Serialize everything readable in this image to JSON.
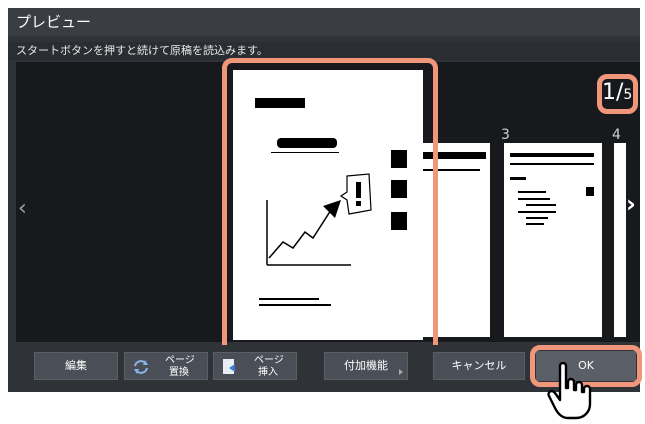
{
  "window": {
    "title": "プレビュー"
  },
  "instruction": "スタートボタンを押すと続けて原稿を読込みます。",
  "page_counter": {
    "current": "1",
    "slash": "/",
    "total": "5"
  },
  "pages": [
    {
      "num": "3"
    },
    {
      "num": "4"
    }
  ],
  "nav": {
    "prev_glyph": "‹",
    "next_glyph": "›"
  },
  "buttons": {
    "edit": "編集",
    "replace_line1": "ページ",
    "replace_line2": "置換",
    "insert_line1": "ページ",
    "insert_line2": "挿入",
    "extra": "付加機能",
    "cancel": "キャンセル",
    "ok": "OK"
  },
  "colors": {
    "highlight": "#f0967a",
    "ok_button": "#5b6068"
  }
}
